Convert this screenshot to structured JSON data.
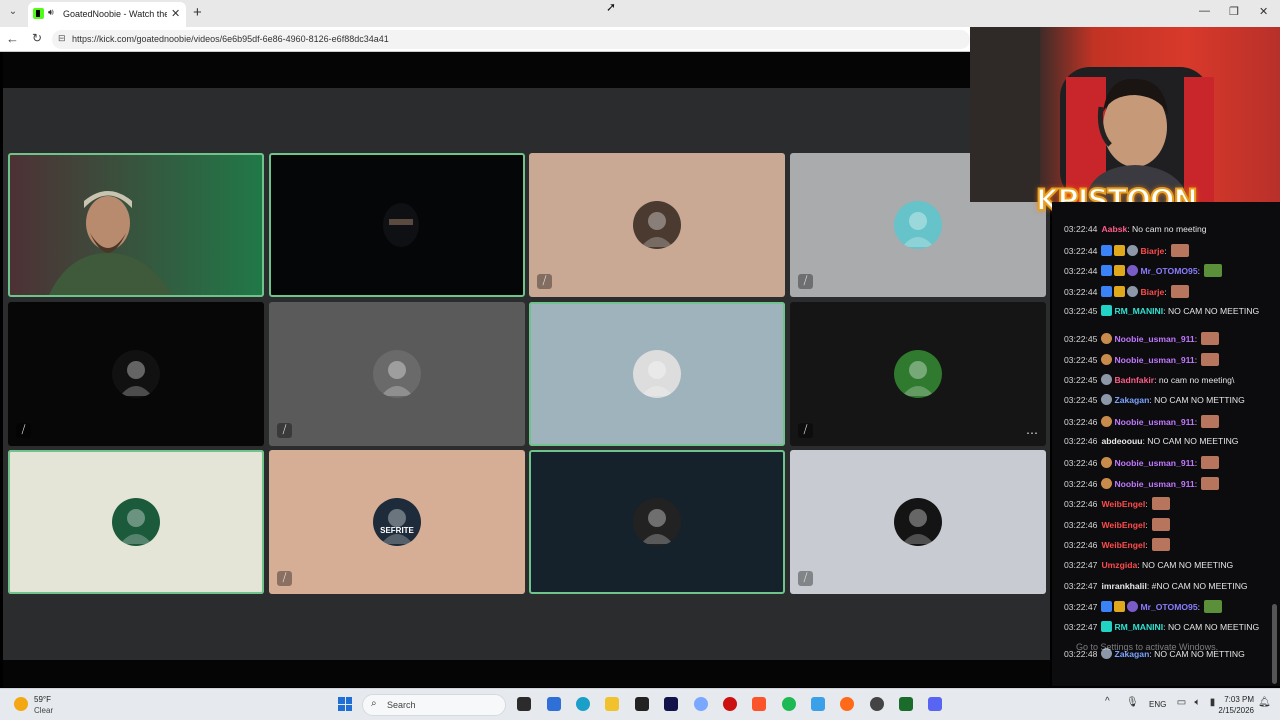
{
  "browser": {
    "tab_title": "GoatedNoobie - Watch the VOD",
    "url": "https://kick.com/goatednoobie/videos/6e6b95df-6e86-4960-8126-e6f88dc34a41"
  },
  "overlay": {
    "logo_text": "KPISTOON"
  },
  "meeting": {
    "tiles": [
      {
        "bg": "#1d3b2c",
        "muted": false,
        "highlight": true,
        "kind": "video-person"
      },
      {
        "bg": "#050608",
        "muted": false,
        "highlight": true,
        "kind": "video-dark"
      },
      {
        "bg": "#c9a894",
        "muted": true,
        "highlight": false,
        "kind": "avatar"
      },
      {
        "bg": "#a9abac",
        "muted": true,
        "highlight": false,
        "kind": "avatar"
      },
      {
        "bg": "#070707",
        "muted": true,
        "highlight": false,
        "kind": "avatar"
      },
      {
        "bg": "#5a5a5a",
        "muted": true,
        "highlight": false,
        "kind": "avatar"
      },
      {
        "bg": "#9fb3bd",
        "muted": false,
        "highlight": true,
        "kind": "avatar"
      },
      {
        "bg": "#151515",
        "muted": true,
        "highlight": false,
        "kind": "avatar",
        "more": true
      },
      {
        "bg": "#e4e5d6",
        "muted": false,
        "highlight": true,
        "kind": "avatar"
      },
      {
        "bg": "#d6ad95",
        "muted": true,
        "highlight": false,
        "kind": "avatar",
        "label": "SEFRITE"
      },
      {
        "bg": "#16222b",
        "muted": false,
        "highlight": true,
        "kind": "avatar"
      },
      {
        "bg": "#c8ccd2",
        "muted": true,
        "highlight": false,
        "kind": "avatar"
      }
    ],
    "more_icon": "⋯"
  },
  "chat": {
    "messages": [
      {
        "time": "03:22:44",
        "user": "Aabsk",
        "color": "#ff5c8a",
        "badges": [],
        "text": "No cam no meeting"
      },
      {
        "time": "03:22:44",
        "user": "Biarje",
        "color": "#ff4b4b",
        "badges": [
          "blue",
          "gold",
          "gray"
        ],
        "text": "",
        "emote": "red"
      },
      {
        "time": "03:22:44",
        "user": "Mr_OTOMO95",
        "color": "#8a7dff",
        "badges": [
          "blue",
          "gold",
          "purple"
        ],
        "text": "",
        "emote": "green"
      },
      {
        "time": "03:22:44",
        "user": "Biarje",
        "color": "#ff4b4b",
        "badges": [
          "blue",
          "gold",
          "gray"
        ],
        "text": "",
        "emote": "red"
      },
      {
        "time": "03:22:45",
        "user": "RM_MANINI",
        "color": "#33e0d0",
        "badges": [
          "teal"
        ],
        "text": "NO CAM NO MEETING",
        "wrap": true
      },
      {
        "time": "03:22:45",
        "user": "Noobie_usman_911",
        "color": "#c178ff",
        "badges": [
          "orange"
        ],
        "text": "",
        "emote": "red"
      },
      {
        "time": "03:22:45",
        "user": "Noobie_usman_911",
        "color": "#c178ff",
        "badges": [
          "orange"
        ],
        "text": "",
        "emote": "red"
      },
      {
        "time": "03:22:45",
        "user": "Badnfakir",
        "color": "#ff5c8a",
        "badges": [
          "gray"
        ],
        "text": "no cam no meeting\\"
      },
      {
        "time": "03:22:45",
        "user": "Zakagan",
        "color": "#7aa2ff",
        "badges": [
          "gray"
        ],
        "text": "NO CAM NO METTING"
      },
      {
        "time": "03:22:46",
        "user": "Noobie_usman_911",
        "color": "#c178ff",
        "badges": [
          "orange"
        ],
        "text": "",
        "emote": "red"
      },
      {
        "time": "03:22:46",
        "user": "abdeoouu",
        "color": "#e8e8e8",
        "badges": [],
        "text": "NO CAM NO MEETING"
      },
      {
        "time": "03:22:46",
        "user": "Noobie_usman_911",
        "color": "#c178ff",
        "badges": [
          "orange"
        ],
        "text": "",
        "emote": "red"
      },
      {
        "time": "03:22:46",
        "user": "Noobie_usman_911",
        "color": "#c178ff",
        "badges": [
          "orange"
        ],
        "text": "",
        "emote": "red"
      },
      {
        "time": "03:22:46",
        "user": "WeibEngel",
        "color": "#ff4b4b",
        "badges": [],
        "text": "",
        "emote": "red"
      },
      {
        "time": "03:22:46",
        "user": "WeibEngel",
        "color": "#ff4b4b",
        "badges": [],
        "text": "",
        "emote": "red"
      },
      {
        "time": "03:22:46",
        "user": "WeibEngel",
        "color": "#ff4b4b",
        "badges": [],
        "text": "",
        "emote": "red"
      },
      {
        "time": "03:22:47",
        "user": "Umzgida",
        "color": "#ff4b4b",
        "badges": [],
        "text": "NO CAM NO MEETING"
      },
      {
        "time": "03:22:47",
        "user": "imrankhalil",
        "color": "#e8e8e8",
        "badges": [],
        "text": "#NO CAM NO MEETING"
      },
      {
        "time": "03:22:47",
        "user": "Mr_OTOMO95",
        "color": "#8a7dff",
        "badges": [
          "blue",
          "gold",
          "purple"
        ],
        "text": "",
        "emote": "green"
      },
      {
        "time": "03:22:47",
        "user": "RM_MANINI",
        "color": "#33e0d0",
        "badges": [
          "teal"
        ],
        "text": "NO CAM NO MEETING",
        "wrap": true
      },
      {
        "time": "03:22:48",
        "user": "Zakagan",
        "color": "#7aa2ff",
        "badges": [
          "gray"
        ],
        "text": "NO CAM NO METTING"
      }
    ],
    "watermark": "Go to Settings to activate Windows."
  },
  "taskbar": {
    "temp": "59°F",
    "condition": "Clear",
    "search_label": "Search",
    "lang": "ENG",
    "time": "7:03 PM",
    "date": "2/15/2026"
  }
}
